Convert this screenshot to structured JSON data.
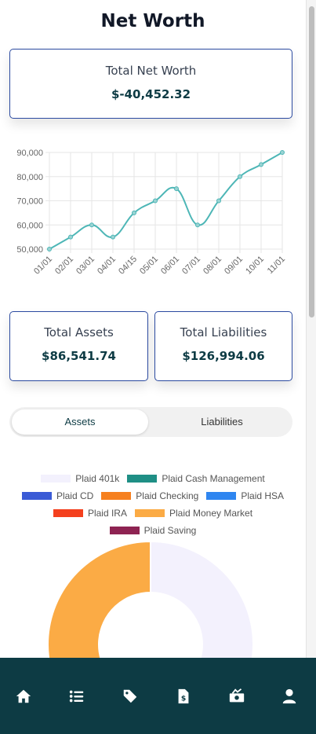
{
  "page": {
    "title": "Net Worth"
  },
  "net_worth": {
    "label": "Total Net Worth",
    "value": "$-40,452.32"
  },
  "totals": {
    "assets": {
      "label": "Total Assets",
      "value": "$86,541.74"
    },
    "liabilities": {
      "label": "Total Liabilities",
      "value": "$126,994.06"
    }
  },
  "tabs": [
    {
      "label": "Assets",
      "active": true
    },
    {
      "label": "Liabilities",
      "active": false
    }
  ],
  "chart_data": [
    {
      "type": "line",
      "categories": [
        "01/01",
        "02/01",
        "03/01",
        "04/01",
        "04/15",
        "05/01",
        "06/01",
        "07/01",
        "08/01",
        "09/01",
        "10/01",
        "11/01"
      ],
      "series": [
        {
          "values": [
            50000,
            55000,
            60000,
            55000,
            65000,
            70000,
            75000,
            60000,
            70000,
            80000,
            85000,
            90000
          ],
          "color": "#4db6b6"
        }
      ],
      "yticks": [
        "90,000",
        "80,000",
        "70,000",
        "60,000",
        "50,000"
      ],
      "ylim": [
        50000,
        90000
      ],
      "grid": true
    },
    {
      "type": "pie",
      "categories": [
        "Plaid 401k",
        "Plaid Cash Management",
        "Plaid CD",
        "Plaid Checking",
        "Plaid HSA",
        "Plaid IRA",
        "Plaid Money Market",
        "Plaid Saving"
      ],
      "values": [
        49.5,
        2.0,
        1.0,
        0.0,
        0.0,
        0.0,
        47.5,
        0.0
      ],
      "colors": [
        "#f3f1fd",
        "#1f8f85",
        "#3b5bd6",
        "#f6801f",
        "#2f86f0",
        "#f4401e",
        "#fbab45",
        "#8e2352"
      ],
      "legend": "top"
    }
  ],
  "nav": {
    "icons": [
      "home-icon",
      "list-icon",
      "tag-icon",
      "invoice-icon",
      "money-icon",
      "user-icon"
    ]
  }
}
